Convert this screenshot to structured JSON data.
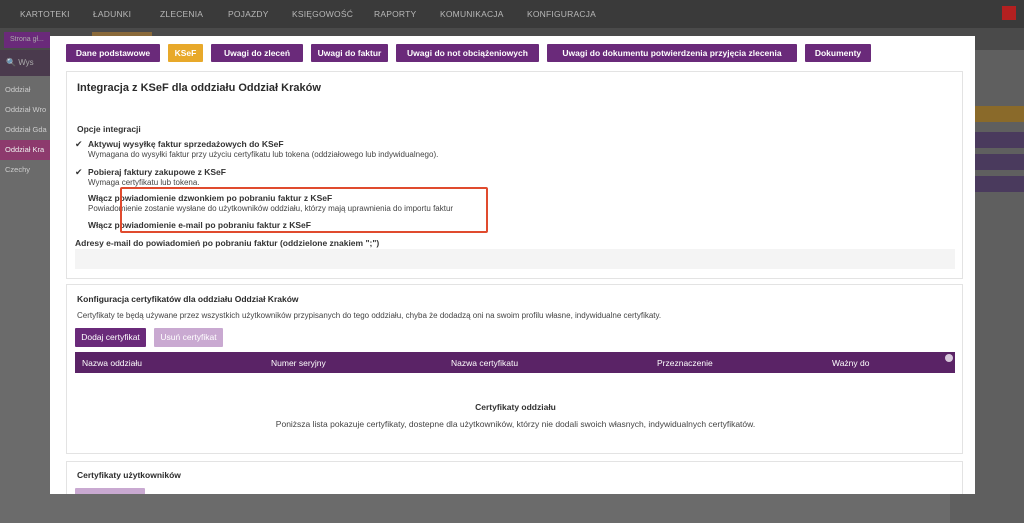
{
  "topnav": {
    "items": [
      "KARTOTEKI",
      "ŁADUNKI",
      "ZLECENIA",
      "POJAZDY",
      "KSIĘGOWOŚĆ",
      "RAPORTY",
      "KOMUNIKACJA",
      "KONFIGURACJA"
    ]
  },
  "background": {
    "tab": "Strona gł...",
    "search": "Wys",
    "sidebar": [
      "Oddział",
      "Oddział Wro",
      "Oddział Gda",
      "Oddział Kra",
      "Czechy"
    ]
  },
  "modal": {
    "tabs": [
      "Dane podstawowe",
      "KSeF",
      "Uwagi do zleceń",
      "Uwagi do faktur",
      "Uwagi do not obciążeniowych",
      "Uwagi do dokumentu potwierdzenia przyjęcia zlecenia",
      "Dokumenty"
    ],
    "active_tab": "KSeF",
    "integration": {
      "title": "Integracja z KSeF dla oddziału Oddział Kraków",
      "options_label": "Opcje integracji",
      "options": [
        {
          "checked": true,
          "title": "Aktywuj wysyłkę faktur sprzedażowych do KSeF",
          "desc": "Wymagana do wysyłki faktur przy użyciu certyfikatu lub tokena (oddziałowego lub indywidualnego)."
        },
        {
          "checked": true,
          "title": "Pobieraj faktury zakupowe z KSeF",
          "desc": "Wymaga certyfikatu lub tokena."
        },
        {
          "checked": false,
          "title": "Włącz powiadomienie dzwonkiem po pobraniu faktur z KSeF",
          "desc": "Powiadomienie zostanie wysłane do użytkowników oddziału, którzy mają uprawnienia do importu faktur"
        },
        {
          "checked": false,
          "title": "Włącz powiadomienie e-mail po pobraniu faktur z KSeF",
          "desc": ""
        }
      ],
      "check_symbol": "✔",
      "email_label": "Adresy e-mail do powiadomień po pobraniu faktur (oddzielone znakiem \";\")",
      "email_value": ""
    },
    "certificates": {
      "title": "Konfiguracja certyfikatów dla oddziału Oddział Kraków",
      "desc": "Certyfikaty te będą używane przez wszystkich użytkowników przypisanych do tego oddziału, chyba że dodadzą oni na swoim profilu własne, indywidualne certyfikaty.",
      "add_button": "Dodaj certyfikat",
      "remove_button": "Usuń certyfikat",
      "columns": [
        "Nazwa oddziału",
        "Numer seryjny",
        "Nazwa certyfikatu",
        "Przeznaczenie",
        "Ważny do"
      ],
      "empty_title": "Certyfikaty oddziału",
      "empty_desc": "Poniższa lista pokazuje certyfikaty, dostepne dla użytkowników, którzy nie dodali swoich własnych, indywidualnych certyfikatów."
    },
    "user_certificates": {
      "title": "Certyfikaty użytkowników"
    }
  },
  "colors": {
    "accent_purple": "#6a2a7a",
    "active_tab": "#e8a92a",
    "highlight_border": "#e04b2e"
  }
}
